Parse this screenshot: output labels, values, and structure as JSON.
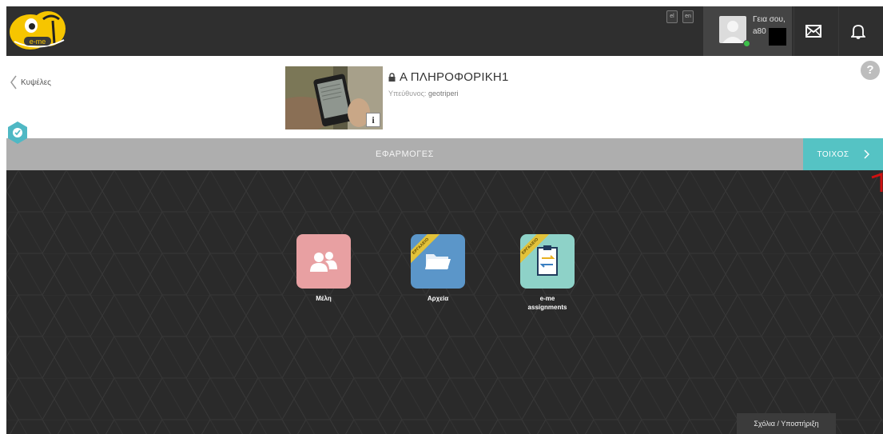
{
  "topbar": {
    "logo_text": "e-me",
    "lang_el": "el",
    "lang_en": "en",
    "greeting": "Γεια σου,",
    "username": "a80"
  },
  "header": {
    "back_label": "Κυψέλες",
    "course_title": "Α ΠΛΗΡΟΦΟΡΙΚΗ1",
    "owner_label": "Υπεύθυνος:",
    "owner_name": "geotriperi",
    "info_glyph": "i",
    "help_glyph": "?"
  },
  "appsbar": {
    "title": "ΕΦΑΡΜΟΓΕΣ",
    "wall_label": "ΤΟΙΧΟΣ"
  },
  "apps": [
    {
      "label": "Μέλη",
      "color": "#e8a0a2",
      "icon": "users-icon",
      "ribbon": ""
    },
    {
      "label": "Αρχεία",
      "color": "#5b96c9",
      "icon": "folder-icon",
      "ribbon": "ΕΡΓΑΛΕΙΟ"
    },
    {
      "label": "e-me\nassignments",
      "color": "#8ed2c8",
      "icon": "assignment-icon",
      "ribbon": "ΕΡΓΑΛΕΙΟ"
    }
  ],
  "footer": {
    "help_label": "Σχόλια / Υποστήριξη"
  },
  "colors": {
    "topbar": "#2f2f2f",
    "appsbar": "#aeaeae",
    "accent_teal": "#55c3c4",
    "background": "#2a2a2a"
  }
}
